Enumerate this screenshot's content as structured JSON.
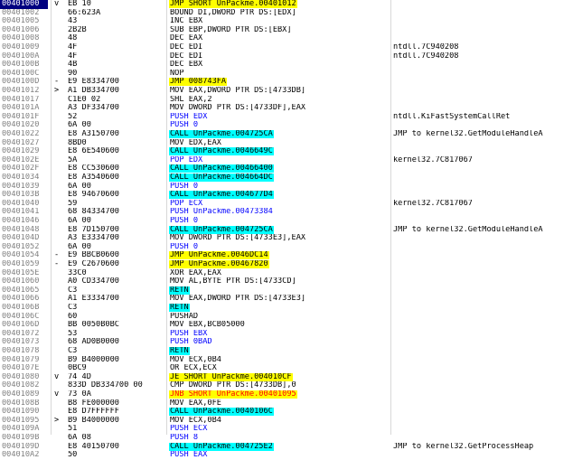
{
  "window": {
    "title": ""
  },
  "colors": {
    "selection_bg": "#000080",
    "jump_highlight": "#ffff00",
    "call_highlight": "#00ffff",
    "red_text": "#ff0000",
    "blue_text": "#0000ff",
    "orange_text": "#ff8000"
  },
  "rows": [
    {
      "addr": "00401000",
      "mark": "v",
      "hex": "EB 10",
      "asm": "JMP SHORT UnPackme.00401012",
      "style": "jmp",
      "comment": ""
    },
    {
      "addr": "00401002",
      "mark": "",
      "hex": "66:623A",
      "asm": "BOUND DI,DWORD PTR DS:[EDX]",
      "style": "",
      "comment": ""
    },
    {
      "addr": "00401005",
      "mark": "",
      "hex": "43",
      "asm": "INC EBX",
      "style": "",
      "comment": ""
    },
    {
      "addr": "00401006",
      "mark": "",
      "hex": "2B2B",
      "asm": "SUB EBP,DWORD PTR DS:[EBX]",
      "style": "",
      "comment": ""
    },
    {
      "addr": "00401008",
      "mark": "",
      "hex": "48",
      "asm": "DEC EAX",
      "style": "",
      "comment": ""
    },
    {
      "addr": "00401009",
      "mark": "",
      "hex": "4F",
      "asm": "DEC EDI",
      "style": "",
      "comment": "ntdll.7C940208"
    },
    {
      "addr": "0040100A",
      "mark": "",
      "hex": "4F",
      "asm": "DEC EDI",
      "style": "",
      "comment": "ntdll.7C940208"
    },
    {
      "addr": "0040100B",
      "mark": "",
      "hex": "4B",
      "asm": "DEC EBX",
      "style": "",
      "comment": ""
    },
    {
      "addr": "0040100C",
      "mark": "",
      "hex": "90",
      "asm": "NOP",
      "style": "",
      "comment": ""
    },
    {
      "addr": "0040100D",
      "mark": "-",
      "hex": "E9 E8334700",
      "asm": "JMP 008743FA",
      "style": "jmp",
      "comment": ""
    },
    {
      "addr": "00401012",
      "mark": ">",
      "hex": "A1 DB334700",
      "asm": "MOV EAX,DWORD PTR DS:[4733DB]",
      "style": "",
      "comment": ""
    },
    {
      "addr": "00401017",
      "mark": "",
      "hex": "C1E0 02",
      "asm": "SHL EAX,2",
      "style": "",
      "comment": ""
    },
    {
      "addr": "0040101A",
      "mark": "",
      "hex": "A3 DF334700",
      "asm": "MOV DWORD PTR DS:[4733DF],EAX",
      "style": "",
      "comment": ""
    },
    {
      "addr": "0040101F",
      "mark": "",
      "hex": "52",
      "asm": "PUSH EDX",
      "style": "push",
      "comment": "ntdll.KiFastSystemCallRet"
    },
    {
      "addr": "00401020",
      "mark": "",
      "hex": "6A 00",
      "asm": "PUSH 0",
      "style": "push",
      "comment": ""
    },
    {
      "addr": "00401022",
      "mark": "",
      "hex": "E8 A3150700",
      "asm": "CALL UnPackme.004725CA",
      "style": "call",
      "comment": "JMP to kernel32.GetModuleHandleA"
    },
    {
      "addr": "00401027",
      "mark": "",
      "hex": "8BD0",
      "asm": "MOV EDX,EAX",
      "style": "",
      "comment": ""
    },
    {
      "addr": "00401029",
      "mark": "",
      "hex": "E8 6E540600",
      "asm": "CALL UnPackme.0046649C",
      "style": "call",
      "comment": ""
    },
    {
      "addr": "0040102E",
      "mark": "",
      "hex": "5A",
      "asm": "POP EDX",
      "style": "push",
      "comment": "kernel32.7C817067"
    },
    {
      "addr": "0040102F",
      "mark": "",
      "hex": "E8 CC530600",
      "asm": "CALL UnPackme.00466400",
      "style": "call",
      "comment": ""
    },
    {
      "addr": "00401034",
      "mark": "",
      "hex": "E8 A3540600",
      "asm": "CALL UnPackme.004664DC",
      "style": "call",
      "comment": ""
    },
    {
      "addr": "00401039",
      "mark": "",
      "hex": "6A 00",
      "asm": "PUSH 0",
      "style": "push",
      "comment": ""
    },
    {
      "addr": "0040103B",
      "mark": "",
      "hex": "E8 94670600",
      "asm": "CALL UnPackme.004677D4",
      "style": "call",
      "comment": ""
    },
    {
      "addr": "00401040",
      "mark": "",
      "hex": "59",
      "asm": "POP ECX",
      "style": "push",
      "comment": "kernel32.7C817067"
    },
    {
      "addr": "00401041",
      "mark": "",
      "hex": "68 84334700",
      "asm": "PUSH UnPackme.00473384",
      "style": "push",
      "comment": ""
    },
    {
      "addr": "00401046",
      "mark": "",
      "hex": "6A 00",
      "asm": "PUSH 0",
      "style": "push",
      "comment": ""
    },
    {
      "addr": "00401048",
      "mark": "",
      "hex": "E8 7D150700",
      "asm": "CALL UnPackme.004725CA",
      "style": "call",
      "comment": "JMP to kernel32.GetModuleHandleA"
    },
    {
      "addr": "0040104D",
      "mark": "",
      "hex": "A3 E3334700",
      "asm": "MOV DWORD PTR DS:[4733E3],EAX",
      "style": "",
      "comment": ""
    },
    {
      "addr": "00401052",
      "mark": "",
      "hex": "6A 00",
      "asm": "PUSH 0",
      "style": "push",
      "comment": ""
    },
    {
      "addr": "00401054",
      "mark": "-",
      "hex": "E9 BBCB0600",
      "asm": "JMP UnPackme.0046DC14",
      "style": "jmp",
      "comment": ""
    },
    {
      "addr": "00401059",
      "mark": "-",
      "hex": "E9 C2670600",
      "asm": "JMP UnPackme.00467820",
      "style": "jmp",
      "comment": ""
    },
    {
      "addr": "0040105E",
      "mark": "",
      "hex": "33C0",
      "asm": "XOR EAX,EAX",
      "style": "",
      "comment": ""
    },
    {
      "addr": "00401060",
      "mark": "",
      "hex": "A0 CD334700",
      "asm": "MOV AL,BYTE PTR DS:[4733CD]",
      "style": "",
      "comment": ""
    },
    {
      "addr": "00401065",
      "mark": "",
      "hex": "C3",
      "asm": "RETN",
      "style": "ret",
      "comment": ""
    },
    {
      "addr": "00401066",
      "mark": "",
      "hex": "A1 E3334700",
      "asm": "MOV EAX,DWORD PTR DS:[4733E3]",
      "style": "",
      "comment": ""
    },
    {
      "addr": "0040106B",
      "mark": "",
      "hex": "C3",
      "asm": "RETN",
      "style": "ret",
      "comment": ""
    },
    {
      "addr": "0040106C",
      "mark": "",
      "hex": "60",
      "asm": "PUSHAD",
      "style": "",
      "comment": ""
    },
    {
      "addr": "0040106D",
      "mark": "",
      "hex": "BB 0050B0BC",
      "asm": "MOV EBX,BCB05000",
      "style": "",
      "comment": ""
    },
    {
      "addr": "00401072",
      "mark": "",
      "hex": "53",
      "asm": "PUSH EBX",
      "style": "push",
      "comment": ""
    },
    {
      "addr": "00401073",
      "mark": "",
      "hex": "68 AD0B0000",
      "asm": "PUSH 0BAD",
      "style": "push",
      "comment": ""
    },
    {
      "addr": "00401078",
      "mark": "",
      "hex": "C3",
      "asm": "RETN",
      "style": "ret",
      "comment": ""
    },
    {
      "addr": "00401079",
      "mark": "",
      "hex": "B9 B4000000",
      "asm": "MOV ECX,0B4",
      "style": "",
      "comment": ""
    },
    {
      "addr": "0040107E",
      "mark": "",
      "hex": "0BC9",
      "asm": "OR ECX,ECX",
      "style": "",
      "comment": ""
    },
    {
      "addr": "00401080",
      "mark": "v",
      "hex": "74 4D",
      "asm": "JE SHORT UnPackme.004010CF",
      "style": "jmp",
      "comment": ""
    },
    {
      "addr": "00401082",
      "mark": "",
      "hex": "833D DB334700 00",
      "asm": "CMP DWORD PTR DS:[4733DB],0",
      "style": "",
      "comment": ""
    },
    {
      "addr": "00401089",
      "mark": "v",
      "hex": "73 0A",
      "asm": "JNB SHORT UnPackme.00401095",
      "style": "jmp",
      "comment": ""
    },
    {
      "addr": "0040108B",
      "mark": "",
      "hex": "B8 FE000000",
      "asm": "MOV EAX,0FE",
      "style": "",
      "comment": ""
    },
    {
      "addr": "00401090",
      "mark": "",
      "hex": "E8 D7FFFFFF",
      "asm": "CALL UnPackme.0040106C",
      "style": "call",
      "comment": ""
    },
    {
      "addr": "00401095",
      "mark": ">",
      "hex": "B9 B4000000",
      "asm": "MOV ECX,0B4",
      "style": "",
      "comment": ""
    },
    {
      "addr": "0040109A",
      "mark": "",
      "hex": "51",
      "asm": "PUSH ECX",
      "style": "push",
      "comment": ""
    },
    {
      "addr": "0040109B",
      "mark": "",
      "hex": "6A 08",
      "asm": "PUSH 8",
      "style": "push",
      "comment": ""
    },
    {
      "addr": "0040109D",
      "mark": "",
      "hex": "E8 40150700",
      "asm": "CALL UnPackme.004725E2",
      "style": "call",
      "comment": "JMP to kernel32.GetProcessHeap"
    },
    {
      "addr": "004010A2",
      "mark": "",
      "hex": "50",
      "asm": "PUSH EAX",
      "style": "push",
      "comment": ""
    }
  ]
}
